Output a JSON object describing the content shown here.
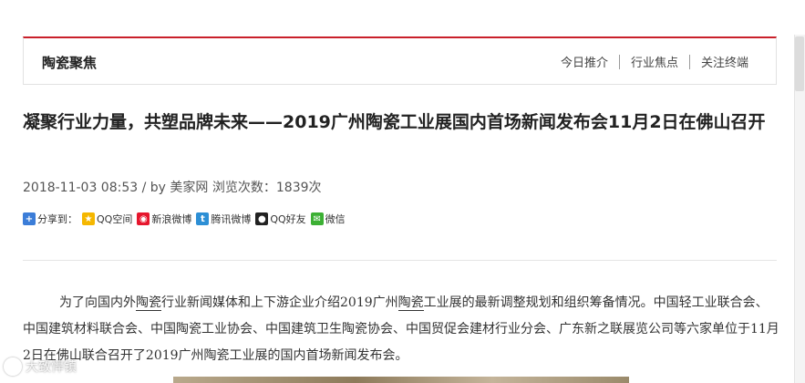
{
  "header": {
    "section_title": "陶瓷聚焦",
    "links": [
      "今日推介",
      "行业焦点",
      "关注终端"
    ]
  },
  "article": {
    "title": "凝聚行业力量，共塑品牌未来——2019广州陶瓷工业展国内首场新闻发布会11月2日在佛山召开",
    "date": "2018-11-03 08:53",
    "by_label": "/ by",
    "author": "美家网",
    "views_label": "浏览次数：",
    "views": "1839",
    "views_unit": "次",
    "body_pre": "为了向国内外",
    "body_kw1": "陶瓷",
    "body_mid1": "行业新闻媒体和上下游企业介绍2019广州",
    "body_kw2": "陶瓷",
    "body_rest": "工业展的最新调整规划和组织筹备情况。中国轻工业联合会、中国建筑材料联合会、中国陶瓷工业协会、中国建筑卫生陶瓷协会、中国贸促会建材行业分会、广东新之联展览公司等六家单位于11月2日在佛山联合召开了2019广州陶瓷工业展的国内首场新闻发布会。"
  },
  "share": {
    "label": "分享到：",
    "items": [
      "QQ空间",
      "新浪微博",
      "腾讯微博",
      "QQ好友",
      "微信"
    ]
  },
  "watermark": {
    "text": "大致悍镇"
  },
  "colors": {
    "accent": "#c9202a"
  }
}
